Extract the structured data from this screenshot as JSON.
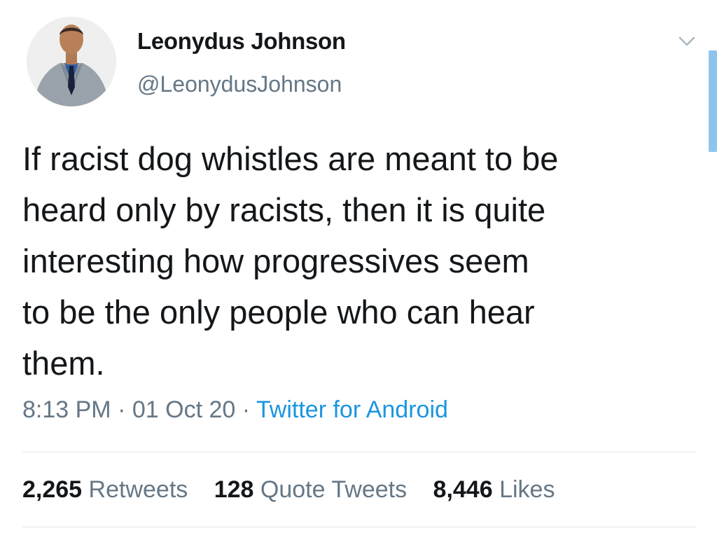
{
  "user": {
    "display_name": "Leonydus Johnson",
    "handle": "@LeonydusJohnson"
  },
  "tweet": {
    "text": "If racist dog whistles are meant to be\nheard only by racists, then it is quite\ninteresting how progressives seem\nto be the only people who can hear\nthem.",
    "time": "8:13 PM",
    "separator": "·",
    "date": "01 Oct 20",
    "source": "Twitter for Android"
  },
  "stats": {
    "retweets_count": "2,265",
    "retweets_label": "Retweets",
    "quote_tweets_count": "128",
    "quote_tweets_label": "Quote Tweets",
    "likes_count": "8,446",
    "likes_label": "Likes"
  },
  "icons": {
    "menu": "chevron-down-icon"
  },
  "colors": {
    "text": "#14171a",
    "secondary": "#657786",
    "link": "#1b95e0",
    "divider": "#e1e8ed"
  }
}
